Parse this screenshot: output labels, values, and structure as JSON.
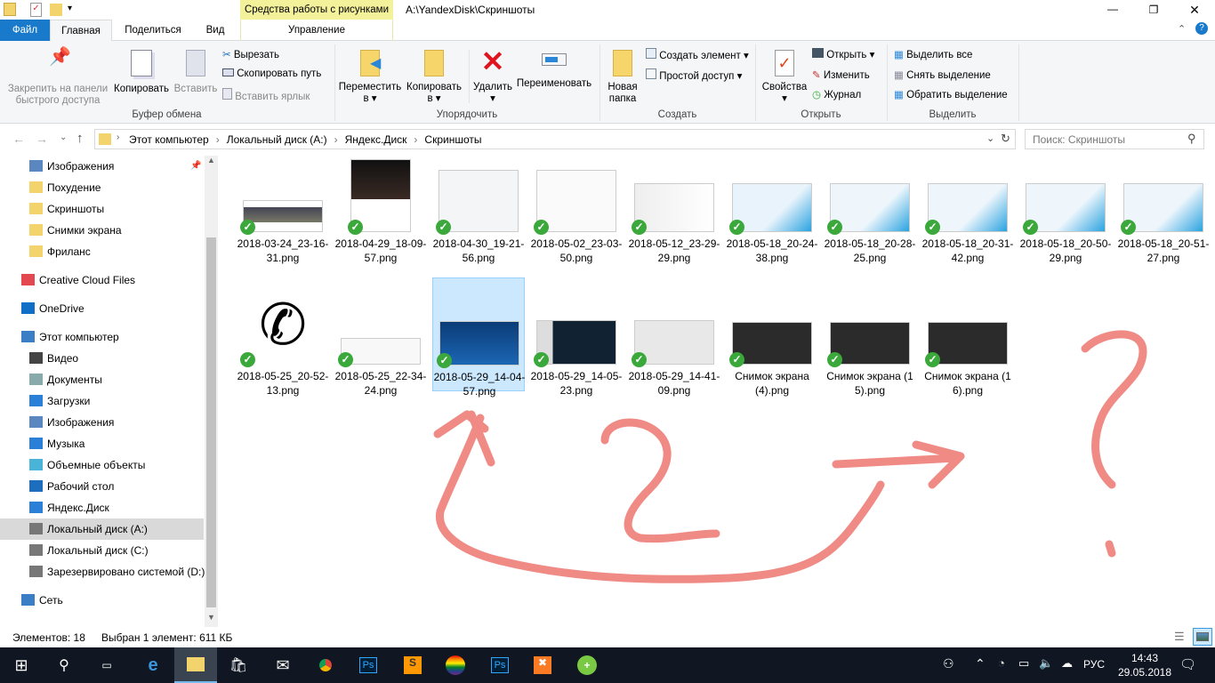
{
  "window": {
    "path": "A:\\YandexDisk\\Скриншоты",
    "context_tab_group": "Средства работы с рисунками",
    "controls": [
      "minimize",
      "maximize",
      "close"
    ]
  },
  "tabs": {
    "file": "Файл",
    "home": "Главная",
    "share": "Поделиться",
    "view": "Вид",
    "manage": "Управление"
  },
  "ribbon": {
    "clipboard": {
      "pin": "Закрепить на панели быстрого доступа",
      "copy": "Копировать",
      "paste": "Вставить",
      "cut": "Вырезать",
      "copy_path": "Скопировать путь",
      "paste_shortcut": "Вставить ярлык",
      "label": "Буфер обмена"
    },
    "organize": {
      "move": "Переместить в",
      "copy_to": "Копировать в",
      "delete": "Удалить",
      "rename": "Переименовать",
      "label": "Упорядочить"
    },
    "new": {
      "new_folder": "Новая папка",
      "new_item": "Создать элемент",
      "easy_access": "Простой доступ",
      "label": "Создать"
    },
    "open": {
      "properties": "Свойства",
      "open": "Открыть",
      "edit": "Изменить",
      "history": "Журнал",
      "label": "Открыть"
    },
    "select": {
      "select_all": "Выделить все",
      "select_none": "Снять выделение",
      "invert": "Обратить выделение",
      "label": "Выделить"
    }
  },
  "address": {
    "crumbs": [
      "Этот компьютер",
      "Локальный диск (A:)",
      "Яндекс.Диск",
      "Скриншоты"
    ],
    "search_placeholder": "Поиск: Скриншоты"
  },
  "nav": [
    {
      "label": "Изображения",
      "icon": "pictures-icon",
      "pinned": true
    },
    {
      "label": "Похудение",
      "icon": "folder-synced-icon"
    },
    {
      "label": "Скриншоты",
      "icon": "folder-synced-icon"
    },
    {
      "label": "Снимки экрана",
      "icon": "folder-icon"
    },
    {
      "label": "Фриланс",
      "icon": "folder-synced-icon"
    },
    {
      "label": "Creative Cloud Files",
      "icon": "creative-cloud-icon"
    },
    {
      "label": "OneDrive",
      "icon": "onedrive-icon"
    },
    {
      "label": "Этот компьютер",
      "icon": "computer-icon"
    },
    {
      "label": "Видео",
      "icon": "video-icon"
    },
    {
      "label": "Документы",
      "icon": "documents-icon"
    },
    {
      "label": "Загрузки",
      "icon": "downloads-icon"
    },
    {
      "label": "Изображения",
      "icon": "pictures-icon"
    },
    {
      "label": "Музыка",
      "icon": "music-icon"
    },
    {
      "label": "Объемные объекты",
      "icon": "3d-objects-icon"
    },
    {
      "label": "Рабочий стол",
      "icon": "desktop-icon"
    },
    {
      "label": "Яндекс.Диск",
      "icon": "yandex-disk-icon"
    },
    {
      "label": "Локальный диск (A:)",
      "icon": "drive-icon",
      "selected": true
    },
    {
      "label": "Локальный диск (C:)",
      "icon": "drive-icon"
    },
    {
      "label": "Зарезервировано системой (D:)",
      "icon": "drive-icon"
    },
    {
      "label": "Сеть",
      "icon": "network-icon"
    }
  ],
  "files": [
    {
      "name": "2018-03-24_23-16-31.png"
    },
    {
      "name": "2018-04-29_18-09-57.png"
    },
    {
      "name": "2018-04-30_19-21-56.png"
    },
    {
      "name": "2018-05-02_23-03-50.png"
    },
    {
      "name": "2018-05-12_23-29-29.png"
    },
    {
      "name": "2018-05-18_20-24-38.png"
    },
    {
      "name": "2018-05-18_20-28-25.png"
    },
    {
      "name": "2018-05-18_20-31-42.png"
    },
    {
      "name": "2018-05-18_20-50-29.png"
    },
    {
      "name": "2018-05-18_20-51-27.png"
    },
    {
      "name": "2018-05-25_20-52-13.png"
    },
    {
      "name": "2018-05-25_22-34-24.png"
    },
    {
      "name": "2018-05-29_14-04-57.png",
      "selected": true
    },
    {
      "name": "2018-05-29_14-05-23.png"
    },
    {
      "name": "2018-05-29_14-41-09.png"
    },
    {
      "name": "Снимок экрана (4).png"
    },
    {
      "name": "Снимок экрана (15).png"
    },
    {
      "name": "Снимок экрана (16).png"
    }
  ],
  "status": {
    "count": "Элементов: 18",
    "selection": "Выбран 1 элемент: 611 КБ"
  },
  "taskbar": {
    "lang": "РУС",
    "time": "14:43",
    "date": "29.05.2018"
  },
  "colors": {
    "accent": "#1979ca",
    "selection": "#cce8ff",
    "annotation": "#f08a85",
    "taskbar": "#101622"
  }
}
